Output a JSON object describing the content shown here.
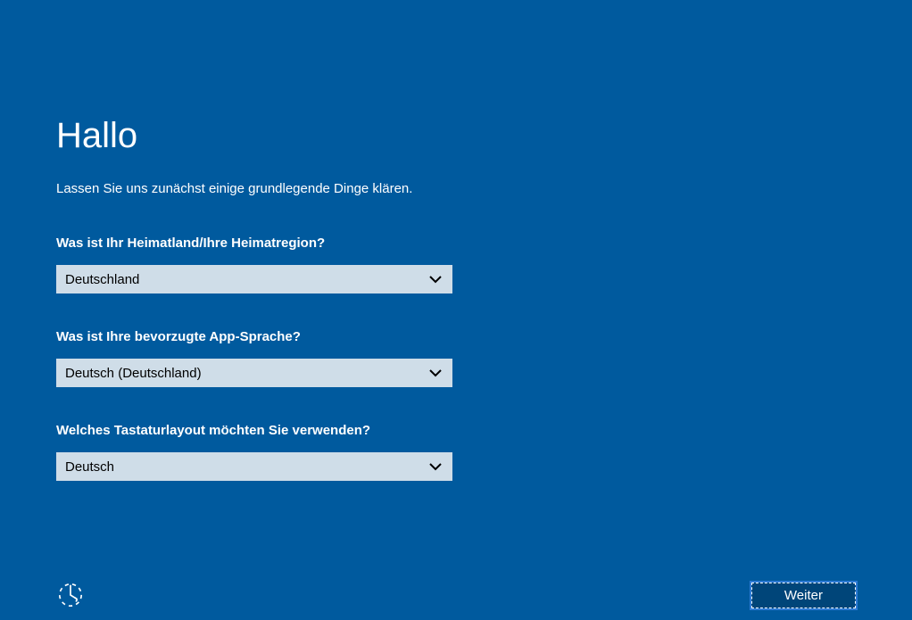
{
  "title": "Hallo",
  "subtitle": "Lassen Sie uns zunächst einige grundlegende Dinge klären.",
  "form": {
    "country": {
      "label": "Was ist Ihr Heimatland/Ihre Heimatregion?",
      "value": "Deutschland"
    },
    "language": {
      "label": "Was ist Ihre bevorzugte App-Sprache?",
      "value": "Deutsch (Deutschland)"
    },
    "keyboard": {
      "label": "Welches Tastaturlayout möchten Sie verwenden?",
      "value": "Deutsch"
    }
  },
  "buttons": {
    "next": "Weiter"
  }
}
